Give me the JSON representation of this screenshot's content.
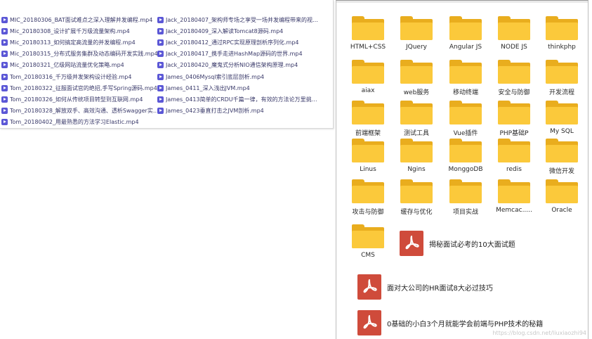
{
  "files": {
    "left_column": [
      "MIC_20180306_BAT面试难点之深入理解并发编程.mp4",
      "Mic_20180308_设计扩展千万级流量架构.mp4",
      "Mic_20180313_如何搞定高流量的并发编程.mp4",
      "Mic_20180315_分布式服务集群及动态编码开发实践.mp4",
      "Mic_20180321_亿级网站流量优化策略.mp4",
      "Tom_20180316_千万级并发架构设计经验.mp4",
      "Tom_20180322_征服面试官的绝招,手写Spring源码.mp4",
      "Tom_20180326_如何从传统项目转型到互联网.mp4",
      "Tom_20180328_解放双手、高效沟通、透析Swagger实现原理...",
      "Tom_20180402_用最熟悉的方法学习Elastic.mp4"
    ],
    "right_column": [
      "Jack_20180407_架构师专场之享受一场并发编程带来的视觉盛...",
      "Jack_20180409_深入解读Tomcat8源码.mp4",
      "Jack_20180412_通过RPC实现原理剖析序列化.mp4",
      "Jack_20180417_携手走进HashMap源码的世界.mp4",
      "Jack_20180420_魔鬼式分析NIO通信架构原理.mp4",
      "James_0406Mysql索引底层剖析.mp4",
      "James_0411_深入浅出JVM.mp4",
      "James_0413简单的CRDU千篇一律，有效的方法论万里挑一.m...",
      "James_0423垂直打击之JVM剖析.mp4"
    ]
  },
  "folders": [
    "HTML+CSS",
    "JQuery",
    "Angular JS",
    "NODE JS",
    "thinkphp",
    "aiax",
    "web服务",
    "移动终端",
    "安全与防御",
    "开发流程",
    "前端框架",
    "测试工具",
    "Vue插件",
    "PHP基础P",
    "My SQL",
    "Linus",
    "Ngins",
    "MonggoDB",
    "redis",
    "微信开发",
    "攻击与防御",
    "缓存与优化",
    "项目实战",
    "Memcac.....",
    "Oracle",
    "CMS"
  ],
  "pdfs": [
    "揭秘面试必考的10大面试题",
    "面对大公司的HR面试8大必过技巧",
    "0基础的小白3个月就能学会前端与PHP技术的秘籍"
  ],
  "watermark": "https://blog.csdn.net/liuxiaozhi94",
  "colors": {
    "folder_front": "#fbc93b",
    "folder_back": "#e9ad1e",
    "pdf_red": "#cf4b3b",
    "video_icon": "#5b57d6"
  }
}
